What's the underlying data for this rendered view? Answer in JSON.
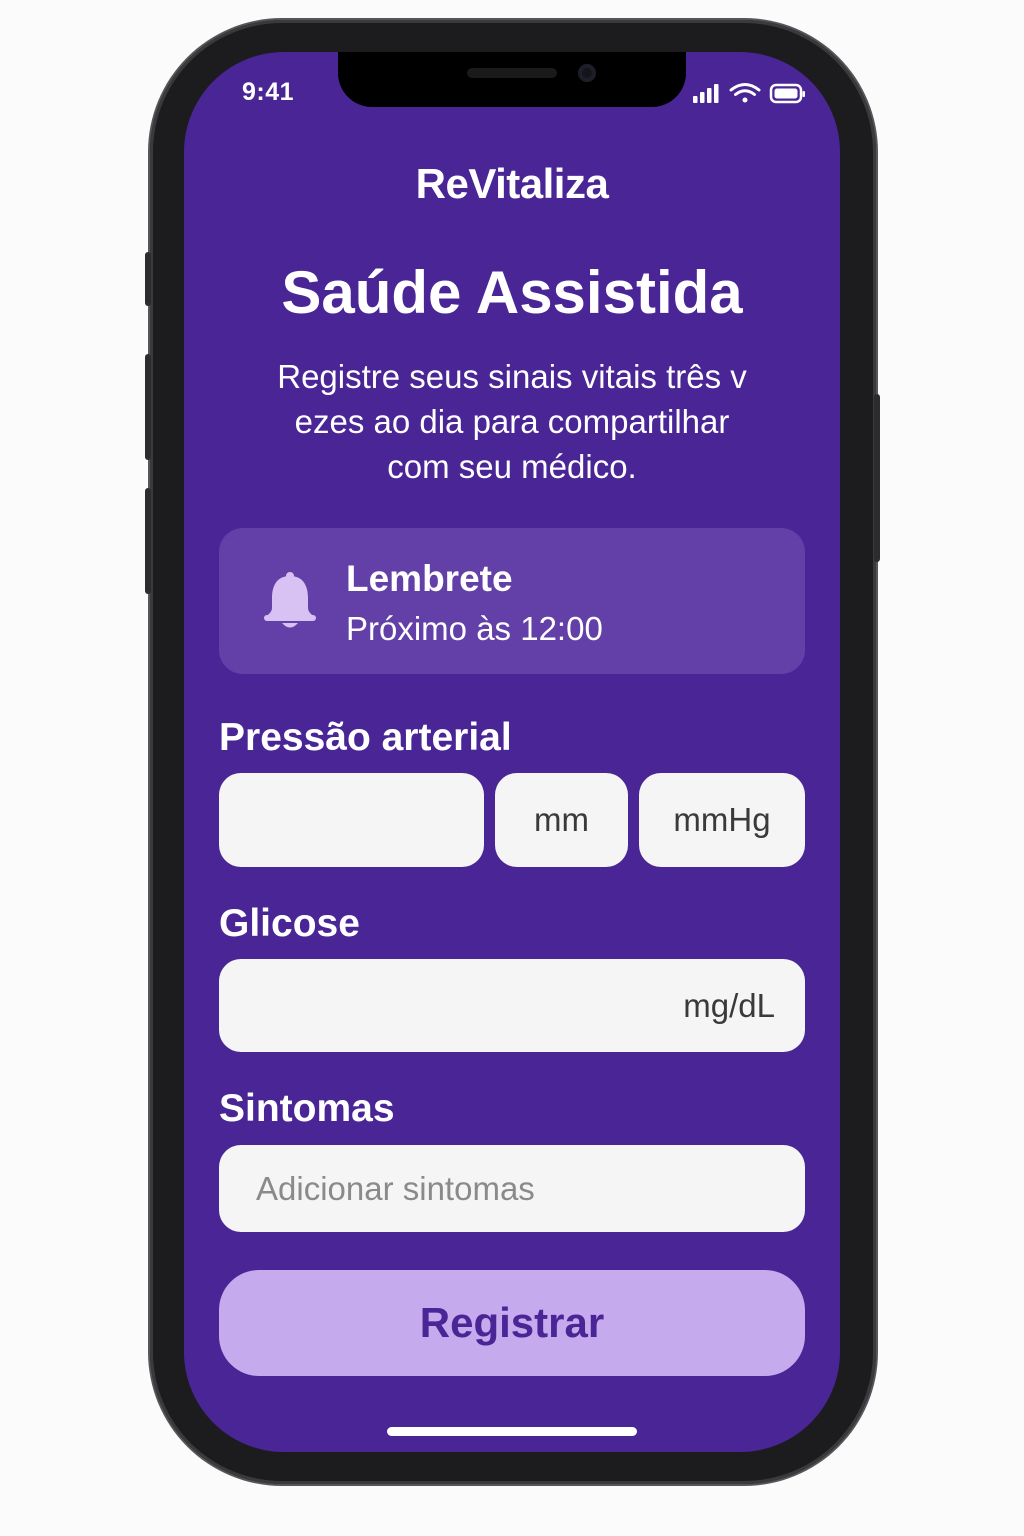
{
  "status_bar": {
    "time": "9:41"
  },
  "app": {
    "name": "ReVitaliza"
  },
  "header": {
    "title": "Saúde Assistida",
    "subtitle_lines": [
      "Registre seus sinais vitais três v",
      "ezes ao dia para compartilhar",
      "com seu médico."
    ]
  },
  "reminder": {
    "icon": "bell-icon",
    "title": "Lembrete",
    "text": "Próximo às 12:00"
  },
  "form": {
    "blood_pressure": {
      "label": "Pressão arterial",
      "value": "",
      "unit_1": "mm",
      "unit_2": "mmHg"
    },
    "glucose": {
      "label": "Glicose",
      "value": "",
      "unit": "mg/dL"
    },
    "symptoms": {
      "label": "Sintomas",
      "placeholder": "Adicionar sintomas"
    }
  },
  "actions": {
    "register_label": "Registrar"
  },
  "colors": {
    "background": "#4a2596",
    "card": "#6340a8",
    "button": "#c5aaee",
    "button_text": "#4a2596",
    "input": "#f5f5f5"
  }
}
